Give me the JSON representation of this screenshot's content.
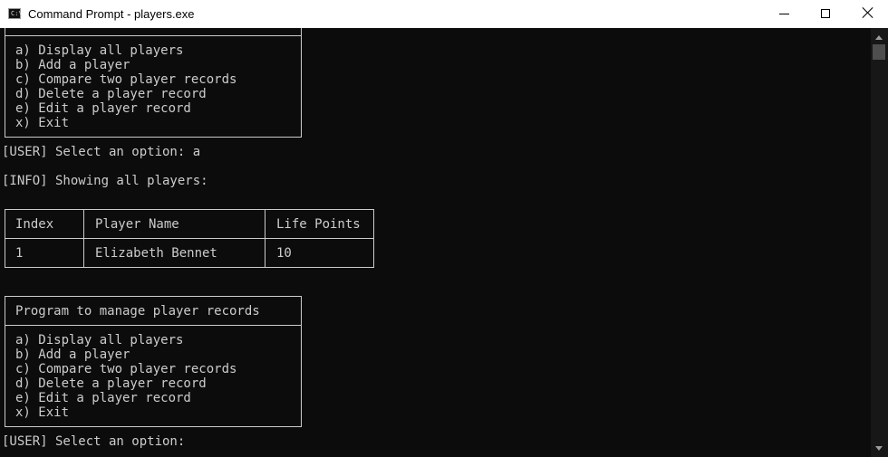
{
  "window": {
    "title": "Command Prompt - players.exe",
    "minimize_icon": "minimize-icon",
    "maximize_icon": "maximize-icon",
    "close_icon": "close-icon"
  },
  "console": {
    "menu_top": {
      "items": [
        "a) Display all players",
        "b) Add a player",
        "c) Compare two player records",
        "d) Delete a player record",
        "e) Edit a player record",
        "x) Exit"
      ]
    },
    "prompt_1": "[USER] Select an option: a",
    "info": "[INFO] Showing all players:",
    "table": {
      "headers": [
        "Index",
        "Player Name",
        "Life Points"
      ],
      "rows": [
        [
          "1",
          "Elizabeth Bennet",
          "10"
        ]
      ]
    },
    "menu_bottom": {
      "title": "Program to manage player records",
      "items": [
        "a) Display all players",
        "b) Add a player",
        "c) Compare two player records",
        "d) Delete a player record",
        "e) Edit a player record",
        "x) Exit"
      ]
    },
    "prompt_2": "[USER] Select an option:"
  },
  "colors": {
    "background": "#0c0c0c",
    "text": "#cccccc",
    "titlebar": "#ffffff"
  }
}
